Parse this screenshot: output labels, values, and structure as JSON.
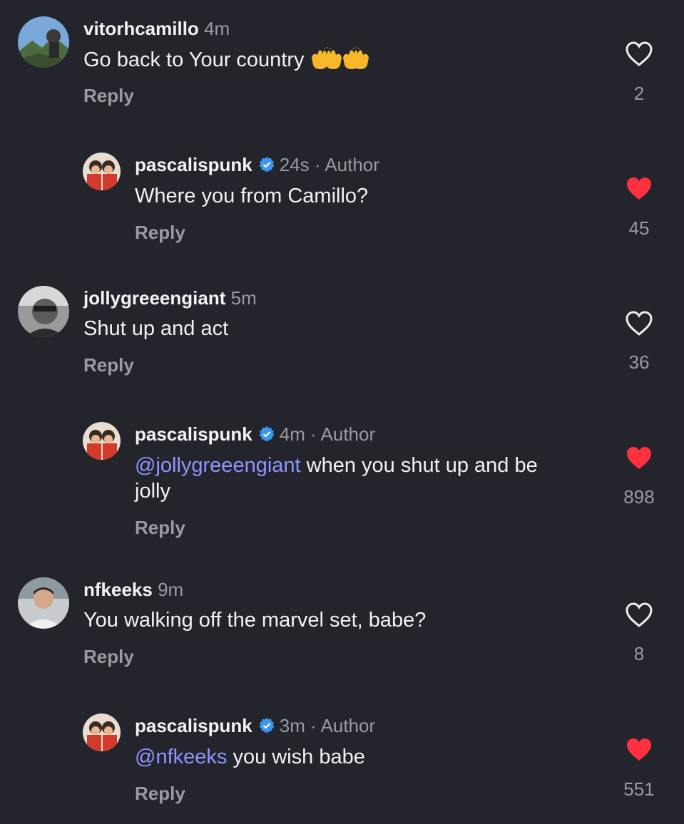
{
  "comments": [
    {
      "username": "vitorhcamillo",
      "time": "4m",
      "text": "Go back to Your country",
      "emoji": "🙌🙌",
      "reply_label": "Reply",
      "likes": "2",
      "liked": false
    },
    {
      "username": "pascalispunk",
      "time": "24s · Author",
      "text": "Where you from Camillo?",
      "reply_label": "Reply",
      "likes": "45",
      "liked": true
    },
    {
      "username": "jollygreeengiant",
      "time": "5m",
      "text": "Shut up and act",
      "reply_label": "Reply",
      "likes": "36",
      "liked": false
    },
    {
      "username": "pascalispunk",
      "time": "4m · Author",
      "mention": "@jollygreeengiant",
      "text_line1": " when you shut up and be",
      "text_line2": "jolly",
      "reply_label": "Reply",
      "likes": "898",
      "liked": true
    },
    {
      "username": "nfkeeks",
      "time": "9m",
      "text": "You walking off the marvel set, babe?",
      "reply_label": "Reply",
      "likes": "8",
      "liked": false
    },
    {
      "username": "pascalispunk",
      "time": "3m · Author",
      "mention": "@nfkeeks",
      "text": " you wish babe",
      "reply_label": "Reply",
      "likes": "551",
      "liked": true
    }
  ],
  "colors": {
    "background": "#24252c",
    "text": "#f2f2f5",
    "muted": "#9a9ba2",
    "mention": "#8f95ff",
    "heart_liked": "#ff3040",
    "verified": "#3897f0"
  },
  "icons": [
    "verified-badge-icon",
    "heart-outline-icon",
    "heart-filled-icon",
    "raising-hands-emoji"
  ]
}
